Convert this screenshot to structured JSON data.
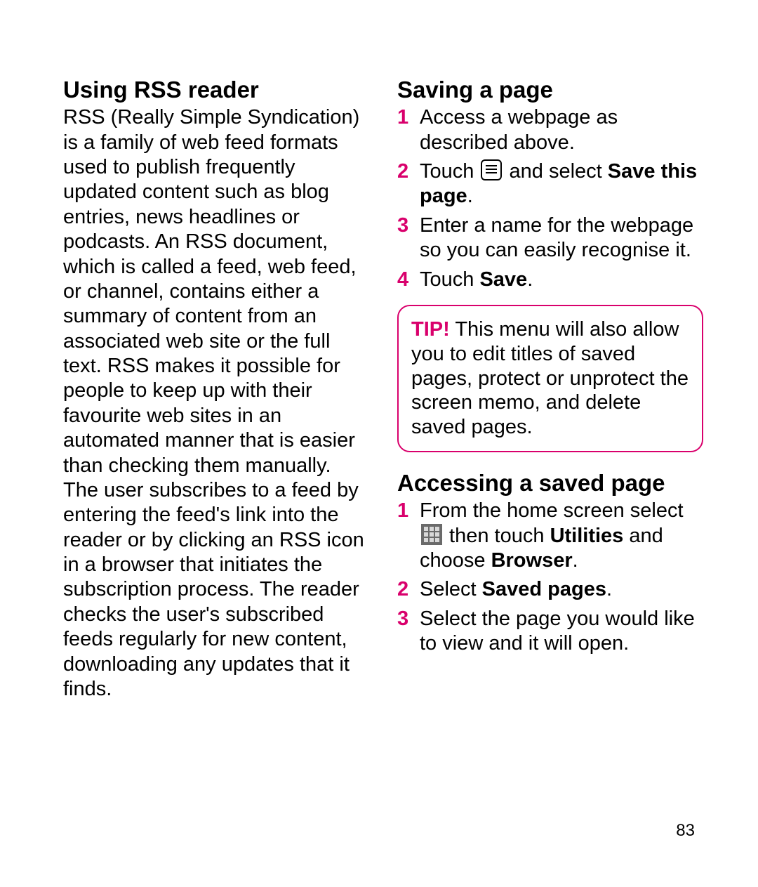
{
  "left": {
    "heading": "Using RSS reader",
    "body": "RSS (Really Simple Syndication) is a family of web feed formats used to publish frequently updated content such as blog entries, news headlines or podcasts. An RSS document, which is called a feed, web feed, or channel, contains either a summary of content from an associated web site or the full text. RSS makes it possible for people to keep up with their favourite web sites in an automated manner that is easier than checking them manually. The user subscribes to a feed by entering the feed's link into the reader or by clicking an RSS icon in a browser that initiates the subscription process. The reader checks the user's subscribed feeds regularly for new content, downloading any updates that it finds."
  },
  "saving": {
    "heading": "Saving a page",
    "steps": {
      "n1": "1",
      "t1": "Access a webpage as described above.",
      "n2": "2",
      "t2a": "Touch ",
      "t2b": " and select ",
      "t2c": "Save this page",
      "t2d": ".",
      "n3": "3",
      "t3": "Enter a name for the webpage so you can easily recognise it.",
      "n4": "4",
      "t4a": "Touch ",
      "t4b": "Save",
      "t4c": "."
    }
  },
  "tip": {
    "label": "TIP!",
    "text": " This menu will also allow you to edit titles of saved pages, protect or unprotect the screen memo, and delete saved pages."
  },
  "accessing": {
    "heading": "Accessing a saved page",
    "steps": {
      "n1": "1",
      "t1a": "From the home screen select ",
      "t1b": " then touch ",
      "t1c": "Utilities",
      "t1d": " and choose ",
      "t1e": "Browser",
      "t1f": ".",
      "n2": "2",
      "t2a": "Select ",
      "t2b": "Saved pages",
      "t2c": ".",
      "n3": "3",
      "t3": "Select the page you would like to view and it will open."
    }
  },
  "page_number": "83"
}
